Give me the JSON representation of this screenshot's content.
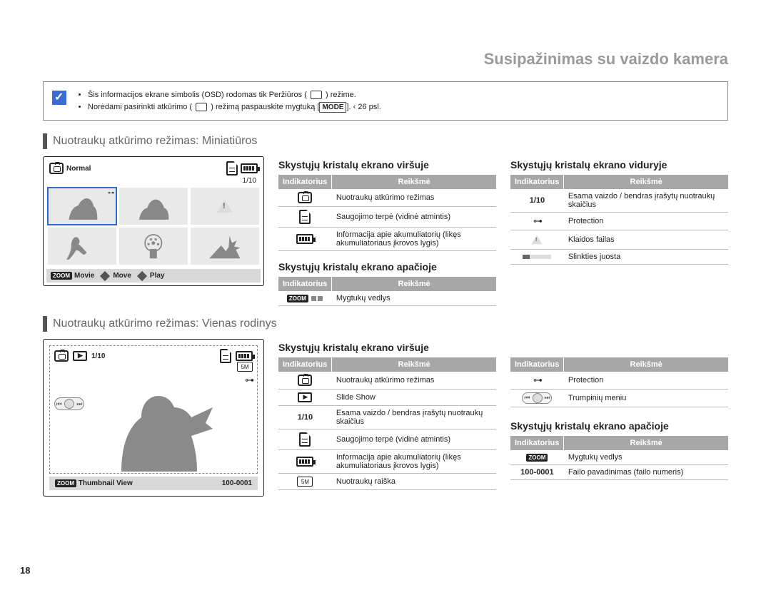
{
  "page": {
    "title": "Susipažinimas su vaizdo kamera",
    "number": "18"
  },
  "note": {
    "line1_a": "Šis informacijos ekrane simbolis (OSD) rodomas tik Peržiūros (",
    "line1_b": ") režime.",
    "line2_a": "Norėdami pasirinkti atkūrimo (",
    "line2_b": ") režimą paspauskite mygtuką [",
    "line2_mode": "MODE",
    "line2_c": "].   ‹  26 psl."
  },
  "section1": "Nuotraukų atkūrimo režimas: Miniatiūros",
  "section2": "Nuotraukų atkūrimo režimas: Vienas rodinys",
  "headers": {
    "indicator": "Indikatorius",
    "meaning": "Reikšmė"
  },
  "subheads": {
    "top": "Skystųjų kristalų ekrano viršuje",
    "bottom": "Skystųjų kristalų ekrano apačioje",
    "middle": "Skystųjų kristalų ekrano viduryje"
  },
  "table_top1": [
    {
      "icon": "photo",
      "text": "Nuotraukų atkūrimo režimas"
    },
    {
      "icon": "card",
      "text": "Saugojimo terpė (vidinė atmintis)"
    },
    {
      "icon": "batt",
      "text": "Informacija apie akumuliatorių (likęs akumuliatoriaus įkrovos lygis)"
    }
  ],
  "table_bottom1": [
    {
      "icon": "zoomdots",
      "text": "Mygtukų vedlys"
    }
  ],
  "table_middle": [
    {
      "icon": "count",
      "label": "1/10",
      "text": "Esama vaizdo / bendras įrašytų nuotraukų skaičius"
    },
    {
      "icon": "key",
      "text": "Protection"
    },
    {
      "icon": "warn",
      "text": "Klaidos failas"
    },
    {
      "icon": "scroll",
      "text": "Slinkties juosta"
    }
  ],
  "table_top2": [
    {
      "icon": "photo",
      "text": "Nuotraukų atkūrimo režimas"
    },
    {
      "icon": "slide",
      "text": "Slide Show"
    },
    {
      "icon": "count",
      "label": "1/10",
      "text": "Esama vaizdo / bendras įrašytų nuotraukų skaičius"
    },
    {
      "icon": "card",
      "text": "Saugojimo terpė (vidinė atmintis)"
    },
    {
      "icon": "batt",
      "text": "Informacija apie akumuliatorių (likęs akumuliatoriaus įkrovos lygis)"
    },
    {
      "icon": "res",
      "label": "5M",
      "text": "Nuotraukų raiška"
    }
  ],
  "table_righttop2": [
    {
      "icon": "key",
      "text": "Protection"
    },
    {
      "icon": "short",
      "text": "Trumpinių meniu"
    }
  ],
  "table_bottom2": [
    {
      "icon": "zoom",
      "text": "Mygtukų vedlys"
    },
    {
      "icon": "file",
      "label": "100-0001",
      "text": "Failo pavadinimas (failo numeris)"
    }
  ],
  "lcd1": {
    "normal": "Normal",
    "count": "1/10",
    "zoom": "ZOOM",
    "movie": "Movie",
    "move": "Move",
    "play": "Play"
  },
  "lcd2": {
    "count": "1/10",
    "zoom": "ZOOM",
    "thumb": "Thumbnail View",
    "file": "100-0001"
  }
}
